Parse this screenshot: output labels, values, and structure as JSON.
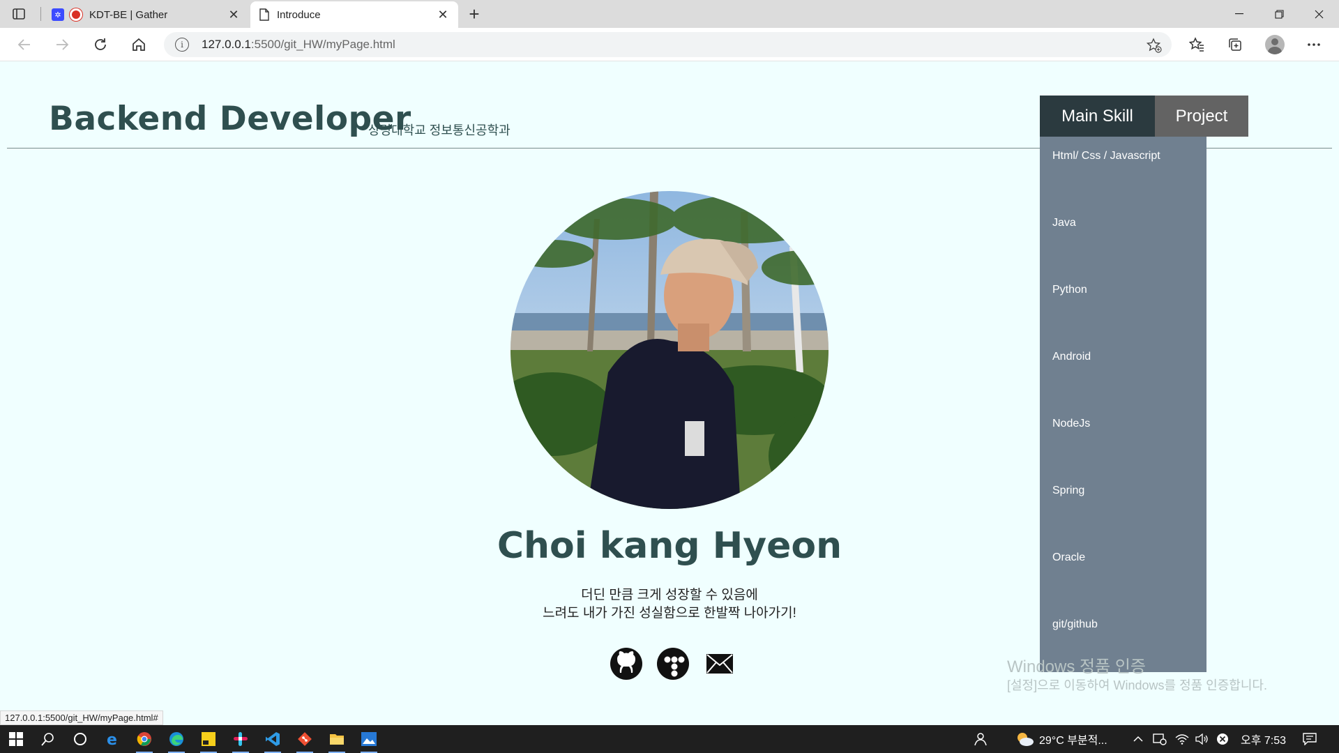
{
  "browser": {
    "tabs": [
      {
        "title": "KDT-BE | Gather",
        "active": false
      },
      {
        "title": "Introduce",
        "active": true
      }
    ],
    "new_tab": "+",
    "window_controls": {
      "minimize": "—",
      "restore": "❐",
      "close": "✕"
    },
    "url_host": "127.0.0.1",
    "url_rest": ":5500/git_HW/myPage.html",
    "status_url": "127.0.0.1:5500/git_HW/myPage.html#"
  },
  "header": {
    "title": "Backend Developer",
    "subtitle": "상명대학교 정보통신공학과"
  },
  "nav": {
    "main_skill": "Main Skill",
    "project": "Project"
  },
  "skills": [
    "Html/ Css / Javascript",
    "Java",
    "Python",
    "Android",
    "NodeJs",
    "Spring",
    "Oracle",
    "git/github"
  ],
  "profile": {
    "name": "Choi kang Hyeon",
    "motto_line1": "더딘 만큼 크게 성장할 수 있음에",
    "motto_line2": "느려도 내가 가진 성실함으로 한발짝 나아가기!"
  },
  "social_icons": [
    "github-icon",
    "blog-icon",
    "mail-icon"
  ],
  "watermark": {
    "line1": "Windows 정품 인증",
    "line2": "[설정]으로 이동하여 Windows를 정품 인증합니다."
  },
  "taskbar": {
    "weather": "29°C  부분적...",
    "time": "오후 7:53"
  },
  "colors": {
    "page_bg": "#f0ffff",
    "title": "#2f4f4f",
    "menu_bg": "#708090",
    "nav_main": "#2b3a3f",
    "nav_project": "#636363"
  }
}
